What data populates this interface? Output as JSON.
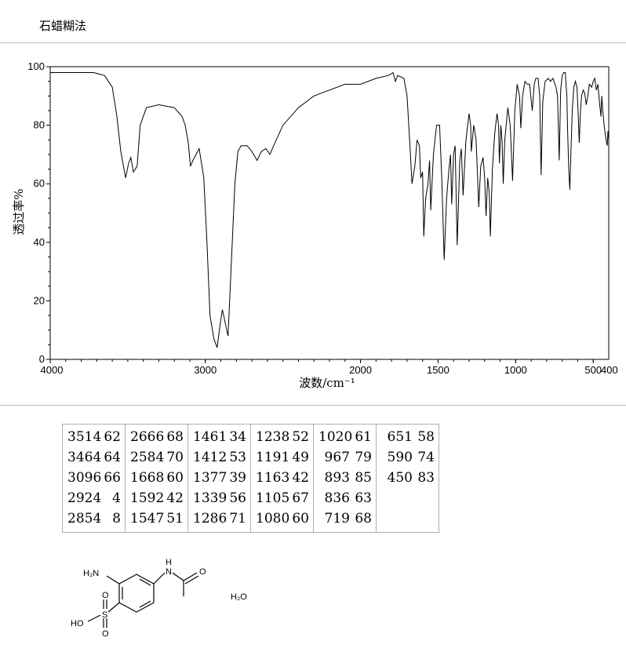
{
  "method_label": "石蜡糊法",
  "chart_data": {
    "type": "line",
    "title": "",
    "xlabel": "波数/cm⁻¹",
    "ylabel": "透过率%",
    "xlim": [
      4000,
      400
    ],
    "ylim": [
      0,
      100
    ],
    "x_ticks": [
      4000,
      3000,
      2000,
      1500,
      1000,
      500
    ],
    "x_tick_labels": [
      "4000",
      "3000",
      "2000",
      "1500",
      "1000",
      "500"
    ],
    "x_end_label": "400",
    "y_ticks": [
      0,
      20,
      40,
      60,
      80,
      100
    ],
    "y_tick_labels": [
      "0",
      "20",
      "40",
      "60",
      "80",
      "100"
    ],
    "series": [
      {
        "points": [
          [
            4000,
            98
          ],
          [
            3720,
            98
          ],
          [
            3650,
            97
          ],
          [
            3600,
            93
          ],
          [
            3570,
            83
          ],
          [
            3545,
            71
          ],
          [
            3514,
            62
          ],
          [
            3495,
            67
          ],
          [
            3480,
            69
          ],
          [
            3464,
            64
          ],
          [
            3440,
            66
          ],
          [
            3420,
            80
          ],
          [
            3380,
            86
          ],
          [
            3300,
            87
          ],
          [
            3200,
            86
          ],
          [
            3150,
            83
          ],
          [
            3130,
            80
          ],
          [
            3110,
            74
          ],
          [
            3096,
            66
          ],
          [
            3080,
            68
          ],
          [
            3060,
            70
          ],
          [
            3040,
            72
          ],
          [
            3010,
            62
          ],
          [
            2990,
            40
          ],
          [
            2970,
            15
          ],
          [
            2945,
            7
          ],
          [
            2924,
            4
          ],
          [
            2905,
            12
          ],
          [
            2890,
            17
          ],
          [
            2870,
            12
          ],
          [
            2854,
            8
          ],
          [
            2835,
            30
          ],
          [
            2810,
            60
          ],
          [
            2790,
            71
          ],
          [
            2770,
            73
          ],
          [
            2730,
            73
          ],
          [
            2700,
            71
          ],
          [
            2666,
            68
          ],
          [
            2640,
            71
          ],
          [
            2610,
            72
          ],
          [
            2584,
            70
          ],
          [
            2560,
            73
          ],
          [
            2500,
            80
          ],
          [
            2400,
            86
          ],
          [
            2300,
            90
          ],
          [
            2200,
            92
          ],
          [
            2100,
            94
          ],
          [
            2000,
            94
          ],
          [
            1900,
            96
          ],
          [
            1820,
            97
          ],
          [
            1790,
            98
          ],
          [
            1775,
            95
          ],
          [
            1760,
            97
          ],
          [
            1720,
            96
          ],
          [
            1700,
            90
          ],
          [
            1680,
            72
          ],
          [
            1668,
            60
          ],
          [
            1650,
            66
          ],
          [
            1635,
            75
          ],
          [
            1620,
            73
          ],
          [
            1612,
            62
          ],
          [
            1600,
            64
          ],
          [
            1592,
            42
          ],
          [
            1580,
            55
          ],
          [
            1565,
            60
          ],
          [
            1555,
            68
          ],
          [
            1547,
            51
          ],
          [
            1530,
            70
          ],
          [
            1510,
            80
          ],
          [
            1490,
            80
          ],
          [
            1475,
            60
          ],
          [
            1461,
            34
          ],
          [
            1445,
            55
          ],
          [
            1430,
            65
          ],
          [
            1420,
            70
          ],
          [
            1412,
            53
          ],
          [
            1400,
            70
          ],
          [
            1390,
            73
          ],
          [
            1377,
            39
          ],
          [
            1360,
            68
          ],
          [
            1350,
            72
          ],
          [
            1339,
            56
          ],
          [
            1320,
            75
          ],
          [
            1300,
            84
          ],
          [
            1290,
            80
          ],
          [
            1286,
            71
          ],
          [
            1270,
            80
          ],
          [
            1255,
            75
          ],
          [
            1238,
            52
          ],
          [
            1225,
            66
          ],
          [
            1210,
            69
          ],
          [
            1200,
            62
          ],
          [
            1191,
            49
          ],
          [
            1180,
            62
          ],
          [
            1170,
            57
          ],
          [
            1163,
            42
          ],
          [
            1150,
            65
          ],
          [
            1135,
            77
          ],
          [
            1120,
            84
          ],
          [
            1110,
            80
          ],
          [
            1105,
            67
          ],
          [
            1095,
            80
          ],
          [
            1087,
            74
          ],
          [
            1080,
            60
          ],
          [
            1070,
            75
          ],
          [
            1050,
            86
          ],
          [
            1035,
            80
          ],
          [
            1020,
            61
          ],
          [
            1005,
            85
          ],
          [
            990,
            94
          ],
          [
            975,
            90
          ],
          [
            967,
            79
          ],
          [
            955,
            90
          ],
          [
            940,
            95
          ],
          [
            925,
            94
          ],
          [
            910,
            94
          ],
          [
            893,
            85
          ],
          [
            880,
            94
          ],
          [
            870,
            96
          ],
          [
            855,
            96
          ],
          [
            845,
            90
          ],
          [
            836,
            63
          ],
          [
            825,
            88
          ],
          [
            810,
            95
          ],
          [
            790,
            96
          ],
          [
            775,
            95
          ],
          [
            760,
            96
          ],
          [
            740,
            93
          ],
          [
            730,
            90
          ],
          [
            719,
            68
          ],
          [
            710,
            92
          ],
          [
            700,
            97
          ],
          [
            690,
            98
          ],
          [
            680,
            98
          ],
          [
            670,
            90
          ],
          [
            665,
            78
          ],
          [
            658,
            65
          ],
          [
            651,
            58
          ],
          [
            644,
            70
          ],
          [
            635,
            85
          ],
          [
            625,
            93
          ],
          [
            615,
            95
          ],
          [
            605,
            93
          ],
          [
            597,
            84
          ],
          [
            590,
            74
          ],
          [
            583,
            84
          ],
          [
            575,
            90
          ],
          [
            565,
            92
          ],
          [
            555,
            91
          ],
          [
            545,
            87
          ],
          [
            535,
            90
          ],
          [
            525,
            94
          ],
          [
            510,
            93
          ],
          [
            500,
            95
          ],
          [
            490,
            96
          ],
          [
            480,
            92
          ],
          [
            470,
            94
          ],
          [
            460,
            88
          ],
          [
            450,
            83
          ],
          [
            445,
            90
          ],
          [
            440,
            86
          ],
          [
            430,
            80
          ],
          [
            420,
            76
          ],
          [
            410,
            73
          ],
          [
            405,
            78
          ],
          [
            400,
            75
          ]
        ]
      }
    ]
  },
  "peak_table": [
    [
      "3514",
      "62"
    ],
    [
      "3464",
      "64"
    ],
    [
      "3096",
      "66"
    ],
    [
      "2924",
      "4"
    ],
    [
      "2854",
      "8"
    ],
    [
      "2666",
      "68"
    ],
    [
      "2584",
      "70"
    ],
    [
      "1668",
      "60"
    ],
    [
      "1592",
      "42"
    ],
    [
      "1547",
      "51"
    ],
    [
      "1461",
      "34"
    ],
    [
      "1412",
      "53"
    ],
    [
      "1377",
      "39"
    ],
    [
      "1339",
      "56"
    ],
    [
      "1286",
      "71"
    ],
    [
      "1238",
      "52"
    ],
    [
      "1191",
      "49"
    ],
    [
      "1163",
      "42"
    ],
    [
      "1105",
      "67"
    ],
    [
      "1080",
      "60"
    ],
    [
      "1020",
      "61"
    ],
    [
      "967",
      "79"
    ],
    [
      "893",
      "85"
    ],
    [
      "836",
      "63"
    ],
    [
      "719",
      "68"
    ],
    [
      "651",
      "58"
    ],
    [
      "590",
      "74"
    ],
    [
      "450",
      "83"
    ]
  ],
  "structure_labels": {
    "amine": "H₂N",
    "amide_nh": "N",
    "amide_h": "H",
    "carbonyl_o": "O",
    "sulfonic_s": "S",
    "sulfonic_o_top": "O",
    "sulfonic_o_bottom": "O",
    "hydroxyl": "HO",
    "hydrate": "H₂O"
  }
}
